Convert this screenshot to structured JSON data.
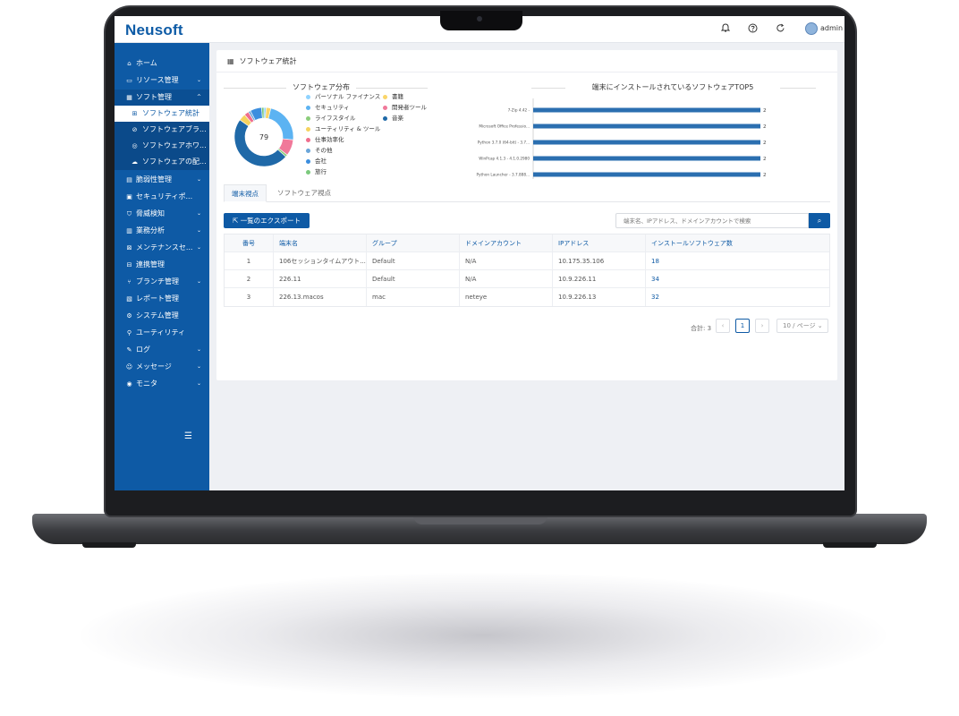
{
  "app": {
    "logo": "Neusoft",
    "user": "admin"
  },
  "topbar_icons": [
    "bell-icon",
    "help-icon",
    "refresh-icon"
  ],
  "sidebar": {
    "items": [
      {
        "label": "ホーム",
        "icon": "home-icon"
      },
      {
        "label": "リソース管理",
        "icon": "monitor-icon",
        "chevron": "⌄"
      },
      {
        "label": "ソフト管理",
        "icon": "grid-icon",
        "chevron": "^"
      },
      {
        "label": "ソフトウェア統計",
        "icon": "table-icon"
      },
      {
        "label": "ソフトウェアブラ...",
        "icon": "block-icon"
      },
      {
        "label": "ソフトウェアホワ...",
        "icon": "check-circle-icon"
      },
      {
        "label": "ソフトウェアの配...",
        "icon": "cloud-icon"
      },
      {
        "label": "脆弱性管理",
        "icon": "document-icon",
        "chevron": "⌄"
      },
      {
        "label": "セキュリティポ...",
        "icon": "policy-icon"
      },
      {
        "label": "脅威検知",
        "icon": "shield-icon",
        "chevron": "⌄"
      },
      {
        "label": "業務分析",
        "icon": "chart-icon",
        "chevron": "⌄"
      },
      {
        "label": "メンテナンスセ...",
        "icon": "tools-icon",
        "chevron": "⌄"
      },
      {
        "label": "連携管理",
        "icon": "link-icon"
      },
      {
        "label": "ブランチ管理",
        "icon": "branch-icon",
        "chevron": "⌄"
      },
      {
        "label": "レポート管理",
        "icon": "report-icon"
      },
      {
        "label": "システム管理",
        "icon": "gear-icon"
      },
      {
        "label": "ユーティリティ",
        "icon": "wrench-icon"
      },
      {
        "label": "ログ",
        "icon": "log-icon",
        "chevron": "⌄"
      },
      {
        "label": "メッセージ",
        "icon": "message-icon",
        "chevron": "⌄"
      },
      {
        "label": "モニタ",
        "icon": "eye-icon",
        "chevron": "⌄"
      }
    ]
  },
  "page": {
    "title": "ソフトウェア統計"
  },
  "chart_data": [
    {
      "type": "pie",
      "title": "ソフトウェア分布",
      "center_label": "79",
      "categories": [
        "パーソナル ファイナンス",
        "書籍",
        "セキュリティ",
        "開発者ツール",
        "ライフスタイル",
        "音楽",
        "ユーティリティ & ツール",
        "仕事効率化",
        "その他",
        "会社",
        "旅行"
      ],
      "values": [
        1,
        2,
        18,
        7,
        1,
        38,
        3,
        2,
        1,
        5,
        1
      ],
      "colors": [
        "#8fd3ff",
        "#fad569",
        "#5cb3f2",
        "#f0799a",
        "#8bcd7a",
        "#1f69a8",
        "#f5d35e",
        "#ef6e8d",
        "#6aa5d9",
        "#3c8ede",
        "#7bc97d"
      ]
    },
    {
      "type": "bar",
      "title": "端末にインストールされているソフトウェアTOP5",
      "categories": [
        "7-Zip 4.42 -",
        "Microsoft Office Professio...",
        "Python 3.7.0 (64-bit) - 3.7...",
        "WinPcap 4.1.3 - 4.1.0.2980",
        "Python Launcher - 3.7.888..."
      ],
      "values": [
        2,
        2,
        2,
        2,
        2
      ],
      "xlim": [
        0,
        2
      ],
      "color": "#2b6fb0"
    }
  ],
  "tabs": [
    {
      "label": "端末視点",
      "active": true
    },
    {
      "label": "ソフトウェア視点",
      "active": false
    }
  ],
  "toolbar": {
    "export_label": "一覧のエクスポート",
    "search_placeholder": "端末名、IPアドレス、ドメインアカウントで検索"
  },
  "table": {
    "headers": [
      "番号",
      "端末名",
      "グループ",
      "ドメインアカウント",
      "IPアドレス",
      "インストールソフトウェア数"
    ],
    "rows": [
      [
        "1",
        "106セッションタイムアウト...",
        "Default",
        "N/A",
        "10.175.35.106",
        "18"
      ],
      [
        "2",
        "226.11",
        "Default",
        "N/A",
        "10.9.226.11",
        "34"
      ],
      [
        "3",
        "226.13.macos",
        "mac",
        "neteye",
        "10.9.226.13",
        "32"
      ]
    ]
  },
  "pagination": {
    "total": "合計: 3",
    "current": "1",
    "page_size": "10 / ページ"
  }
}
